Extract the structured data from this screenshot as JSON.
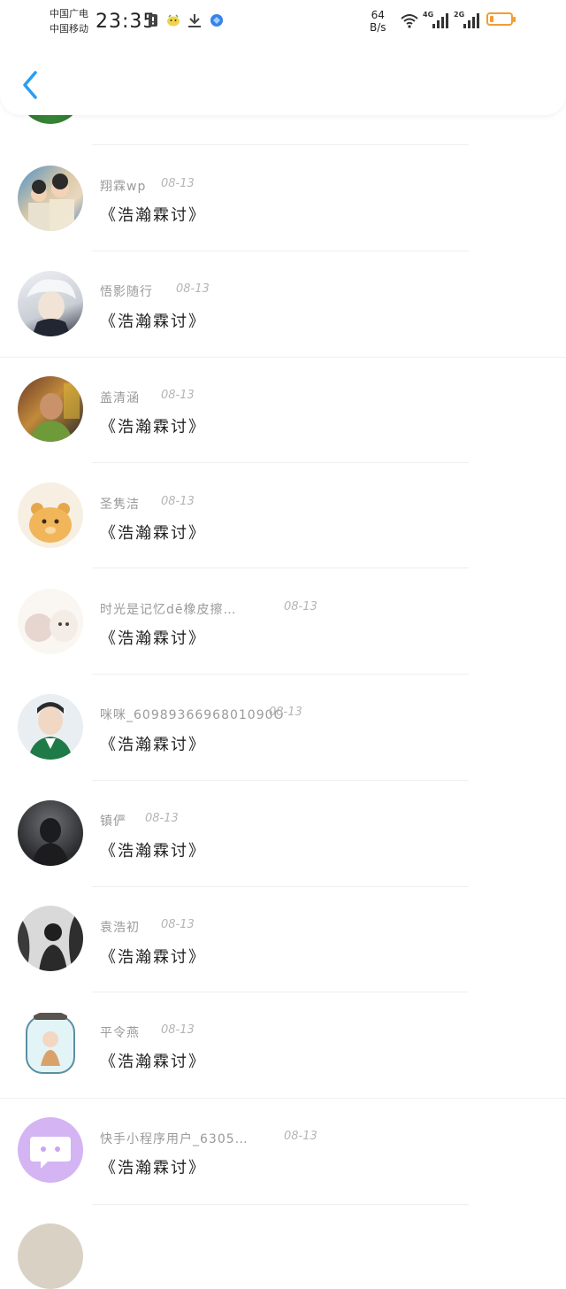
{
  "status_bar": {
    "carrier_top": "中国广电",
    "carrier_bottom": "中国移动",
    "time": "23:35",
    "net_speed_value": "64",
    "net_speed_unit": "B/s",
    "signal1_label": "4G",
    "signal2_label": "2G",
    "battery_level": 0.2,
    "battery_color": "#f39c33"
  },
  "header": {
    "back_icon": "chevron-left-icon",
    "accent_color": "#2a9df4"
  },
  "comments": [
    {
      "user": "翔霖wp",
      "date": "08-13",
      "text": "《浩瀚霖讨》"
    },
    {
      "user": "悟影随行",
      "date": "08-13",
      "text": "《浩瀚霖讨》"
    },
    {
      "user": "盖清涵",
      "date": "08-13",
      "text": "《浩瀚霖讨》"
    },
    {
      "user": "圣隽洁",
      "date": "08-13",
      "text": "《浩瀚霖讨》"
    },
    {
      "user": "时光是记忆dē橡皮擦…",
      "date": "08-13",
      "text": "《浩瀚霖讨》"
    },
    {
      "user": "咪咪_6098936696801090O",
      "date": "08-13",
      "text": "《浩瀚霖讨》"
    },
    {
      "user": "镇俨",
      "date": "08-13",
      "text": "《浩瀚霖讨》"
    },
    {
      "user": "袁浩初",
      "date": "08-13",
      "text": "《浩瀚霖讨》"
    },
    {
      "user": "平令燕",
      "date": "08-13",
      "text": "《浩瀚霖讨》"
    },
    {
      "user": "快手小程序用户_6305…",
      "date": "08-13",
      "text": "《浩瀚霖讨》"
    }
  ]
}
